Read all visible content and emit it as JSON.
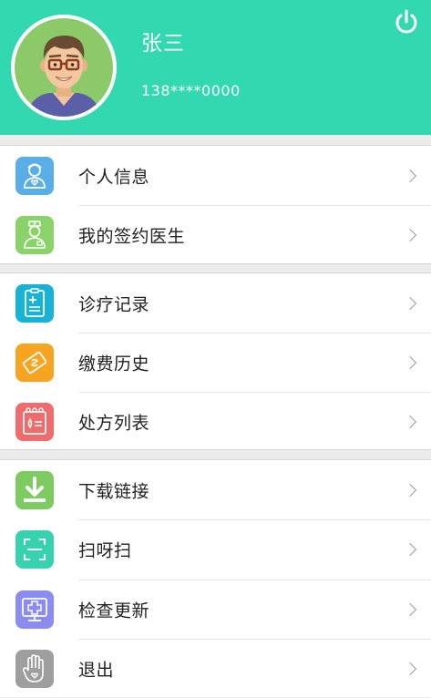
{
  "header": {
    "user_name": "张三",
    "phone": "138****0000",
    "power_icon": "power-icon",
    "avatar_icon": "male-doctor-avatar",
    "background_color": "#32d8af"
  },
  "menu": {
    "section1": [
      {
        "label": "个人信息",
        "icon": "doctor-person-icon",
        "color": "#5aaee8"
      },
      {
        "label": "我的签约医生",
        "icon": "nurse-doctor-icon",
        "color": "#8ad36a"
      }
    ],
    "section2": [
      {
        "label": "诊疗记录",
        "icon": "medical-record-icon",
        "color": "#17b2d6"
      },
      {
        "label": "缴费历史",
        "icon": "payment-icon",
        "color": "#f7a421"
      },
      {
        "label": "处方列表",
        "icon": "prescription-icon",
        "color": "#f06b6b"
      }
    ],
    "section3": [
      {
        "label": "下载链接",
        "icon": "download-icon",
        "color": "#7ccc62"
      },
      {
        "label": "扫呀扫",
        "icon": "scan-icon",
        "color": "#37d3b0"
      },
      {
        "label": "检查更新",
        "icon": "update-monitor-icon",
        "color": "#8b8cf2"
      },
      {
        "label": "退出",
        "icon": "hand-exit-icon",
        "color": "#9e9e9e"
      }
    ]
  }
}
